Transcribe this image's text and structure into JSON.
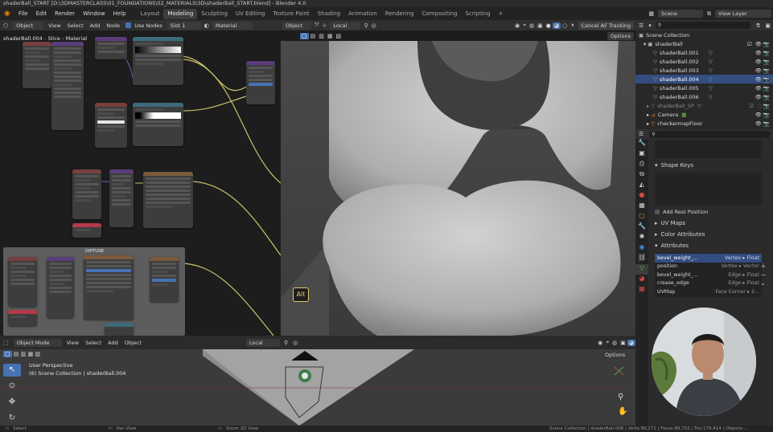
{
  "window": {
    "title": "shaderBall_START [D:\\3DMASTERCLASS\\01_FOUNDATIONS\\02_MATERIALS\\3D\\shaderBall_START.blend] - Blender 4.0"
  },
  "menu": [
    "File",
    "Edit",
    "Render",
    "Window",
    "Help"
  ],
  "workspaces": [
    {
      "label": "Layout",
      "active": false
    },
    {
      "label": "Modeling",
      "active": true
    },
    {
      "label": "Sculpting",
      "active": false
    },
    {
      "label": "UV Editing",
      "active": false
    },
    {
      "label": "Texture Paint",
      "active": false
    },
    {
      "label": "Shading",
      "active": false
    },
    {
      "label": "Animation",
      "active": false
    },
    {
      "label": "Rendering",
      "active": false
    },
    {
      "label": "Compositing",
      "active": false
    },
    {
      "label": "Scripting",
      "active": false
    }
  ],
  "add_workspace": "+",
  "scene": {
    "name": "Scene",
    "view_layer": "View Layer"
  },
  "node_editor": {
    "mode": "Object",
    "menus": [
      "View",
      "Select",
      "Add",
      "Node"
    ],
    "use_nodes": "Use Nodes",
    "slot": "Slot 1",
    "material_label": "Material",
    "breadcrumb_object": "shaderBall.004",
    "breadcrumb_slice": "Slice",
    "breadcrumb_material": "Material",
    "frame_label": "DIFFUSE"
  },
  "viewport": {
    "mode": "Object",
    "orientation": "Local",
    "cancel_button": "Cancel AF Tracking",
    "options": "Options",
    "alt_badge": "Alt"
  },
  "viewport2": {
    "mode": "Object Mode",
    "menus": [
      "View",
      "Select",
      "Add",
      "Object"
    ],
    "orientation": "Local",
    "options": "Options",
    "perspective": "User Perspective",
    "collection": "(6) Scene Collection | shaderBall.004"
  },
  "outliner": {
    "root": "Scene Collection",
    "collection": "shaderBall",
    "items": [
      {
        "label": "shaderBall.001",
        "selected": false
      },
      {
        "label": "shaderBall.002",
        "selected": false
      },
      {
        "label": "shaderBall.003",
        "selected": false
      },
      {
        "label": "shaderBall.004",
        "selected": true
      },
      {
        "label": "shaderBall.005",
        "selected": false
      },
      {
        "label": "shaderBall.006",
        "selected": false
      }
    ],
    "extra": [
      {
        "label": "shaderBall_SP"
      },
      {
        "label": "Camera"
      },
      {
        "label": "checkermapFloor"
      }
    ]
  },
  "properties": {
    "sections": {
      "shape_keys": "Shape Keys",
      "add_rest_position": "Add Rest Position",
      "uv_maps": "UV Maps",
      "color_attributes": "Color Attributes",
      "attributes": "Attributes"
    },
    "attributes": [
      {
        "name": "bevel_weight_...",
        "domain": "Vertex",
        "type": "Float",
        "selected": true
      },
      {
        "name": "position",
        "domain": "Vertex",
        "type": "Vector",
        "selected": false
      },
      {
        "name": "bevel_weight_...",
        "domain": "Edge",
        "type": "Float",
        "selected": false
      },
      {
        "name": "crease_edge",
        "domain": "Edge",
        "type": "Float",
        "selected": false
      },
      {
        "name": "UVMap",
        "domain": "Face Corner",
        "type": "2...",
        "selected": false
      }
    ]
  },
  "status": {
    "left_select": "Select",
    "pan": "Pan View",
    "zoom": "Zoom 2D View",
    "right": "Scene Collection | shaderBall.006 | Verts:90,271 | Faces:89,702 | Tris:179,414 | Objects:..."
  },
  "colors": {
    "accent": "#4772b3",
    "active_tab": "#3d3d3d",
    "background": "#1d1d1d",
    "alt_badge": "#e7c66a"
  },
  "icons": [
    "blender-logo-icon",
    "search-icon",
    "filter-icon",
    "eye-icon",
    "camera-icon",
    "mesh-icon",
    "zoom-icon",
    "hand-icon",
    "cursor-icon",
    "move-icon"
  ]
}
